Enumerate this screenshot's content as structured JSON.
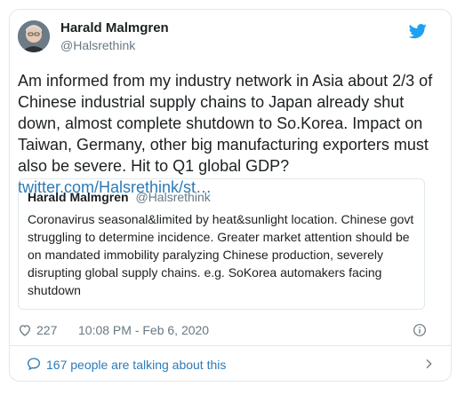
{
  "author": {
    "name": "Harald Malmgren",
    "handle": "@Halsrethink"
  },
  "tweet": {
    "text": "Am informed from my industry network in Asia about 2/3 of Chinese industrial supply chains to Japan already shut down, almost complete shutdown to So.Korea. Impact on Taiwan, Germany, other big manufacturing exporters must also be severe. Hit to Q1 global GDP?",
    "link_text": "twitter.com/Halsrethink/st…"
  },
  "quoted_tweet": {
    "name": "Harald Malmgren",
    "handle": "@Halsrethink",
    "text": "Coronavirus seasonal&limited by heat&sunlight location. Chinese govt struggling to determine incidence. Greater market attention should be on mandated immobility paralyzing Chinese production, severely disrupting global supply chains. e.g. SoKorea automakers facing shutdown"
  },
  "meta": {
    "likes": "227",
    "timestamp": "10:08 PM - Feb 6, 2020"
  },
  "footer": {
    "talking": "167 people are talking about this"
  },
  "colors": {
    "accent": "#1da1f2",
    "link": "#2b7bb9",
    "muted": "#697882",
    "text": "#1c2022",
    "border": "#e1e8ed"
  },
  "icons": {
    "brand": "twitter-bird-icon",
    "like": "heart-icon",
    "info": "info-icon",
    "conversation": "speech-bubble-icon",
    "navigate": "chevron-right-icon"
  }
}
